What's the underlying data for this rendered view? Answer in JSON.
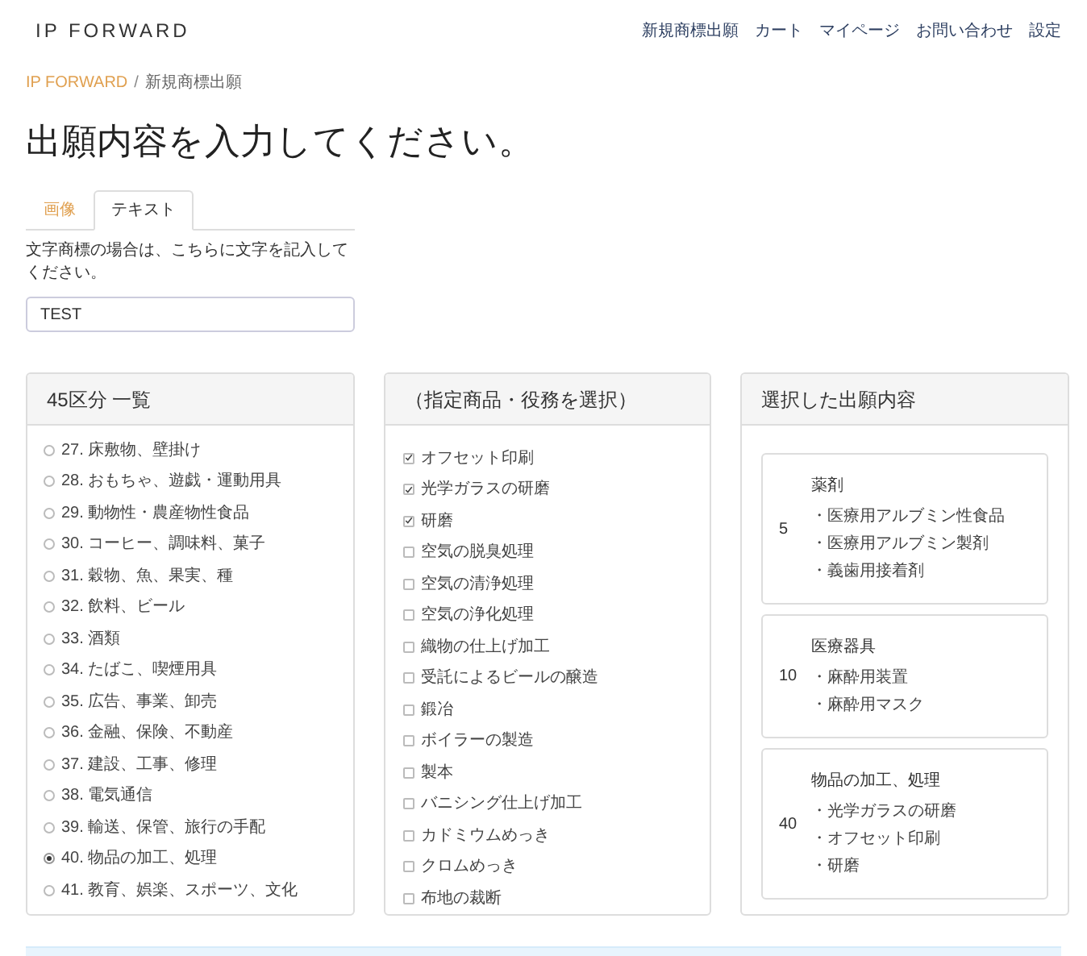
{
  "header": {
    "logo": "IP FORWARD",
    "nav": [
      "新規商標出願",
      "カート",
      "マイページ",
      "お問い合わせ",
      "設定"
    ]
  },
  "breadcrumb": [
    {
      "label": "IP FORWARD",
      "link": true
    },
    {
      "label": "新規商標出願",
      "link": false
    }
  ],
  "breadcrumb_separator": "/",
  "title": "出願内容を入力してください。",
  "tabs": [
    {
      "label": "画像",
      "selected": false
    },
    {
      "label": "テキスト",
      "selected": true
    }
  ],
  "help_text": "文字商標の場合は、こちらに文字を記入してください。",
  "text_field": {
    "value": "TEST"
  },
  "classes_panel": {
    "title": "45区分 一覧",
    "items": [
      {
        "label": "27. 床敷物、壁掛け",
        "selected": false
      },
      {
        "label": "28. おもちゃ、遊戯・運動用具",
        "selected": false
      },
      {
        "label": "29. 動物性・農産物性食品",
        "selected": false
      },
      {
        "label": "30. コーヒー、調味料、菓子",
        "selected": false
      },
      {
        "label": "31. 穀物、魚、果実、種",
        "selected": false
      },
      {
        "label": "32. 飲料、ビール",
        "selected": false
      },
      {
        "label": "33. 酒類",
        "selected": false
      },
      {
        "label": "34. たばこ、喫煙用具",
        "selected": false
      },
      {
        "label": "35. 広告、事業、卸売",
        "selected": false
      },
      {
        "label": "36. 金融、保険、不動産",
        "selected": false
      },
      {
        "label": "37. 建設、工事、修理",
        "selected": false
      },
      {
        "label": "38. 電気通信",
        "selected": false
      },
      {
        "label": "39. 輸送、保管、旅行の手配",
        "selected": false
      },
      {
        "label": "40. 物品の加工、処理",
        "selected": true
      },
      {
        "label": "41. 教育、娯楽、スポーツ、文化",
        "selected": false
      }
    ]
  },
  "goods_panel": {
    "title": "（指定商品・役務を選択）",
    "items": [
      {
        "label": "オフセット印刷",
        "checked": true
      },
      {
        "label": "光学ガラスの研磨",
        "checked": true
      },
      {
        "label": "研磨",
        "checked": true
      },
      {
        "label": "空気の脱臭処理",
        "checked": false
      },
      {
        "label": "空気の清浄処理",
        "checked": false
      },
      {
        "label": "空気の浄化処理",
        "checked": false
      },
      {
        "label": "織物の仕上げ加工",
        "checked": false
      },
      {
        "label": "受託によるビールの醸造",
        "checked": false
      },
      {
        "label": "鍛冶",
        "checked": false
      },
      {
        "label": "ボイラーの製造",
        "checked": false
      },
      {
        "label": "製本",
        "checked": false
      },
      {
        "label": "バニシング仕上げ加工",
        "checked": false
      },
      {
        "label": "カドミウムめっき",
        "checked": false
      },
      {
        "label": "クロムめっき",
        "checked": false
      },
      {
        "label": "布地の裁断",
        "checked": false
      }
    ]
  },
  "selection_panel": {
    "title": "選択した出願内容",
    "cards": [
      {
        "number": "5",
        "category": "薬剤",
        "items": [
          "・医療用アルブミン性食品",
          "・医療用アルブミン製剤",
          "・義歯用接着剤"
        ]
      },
      {
        "number": "10",
        "category": "医療器具",
        "items": [
          "・麻酔用装置",
          "・麻酔用マスク"
        ]
      },
      {
        "number": "40",
        "category": "物品の加工、処理",
        "items": [
          "・光学ガラスの研磨",
          "・オフセット印刷",
          "・研磨"
        ]
      }
    ]
  }
}
